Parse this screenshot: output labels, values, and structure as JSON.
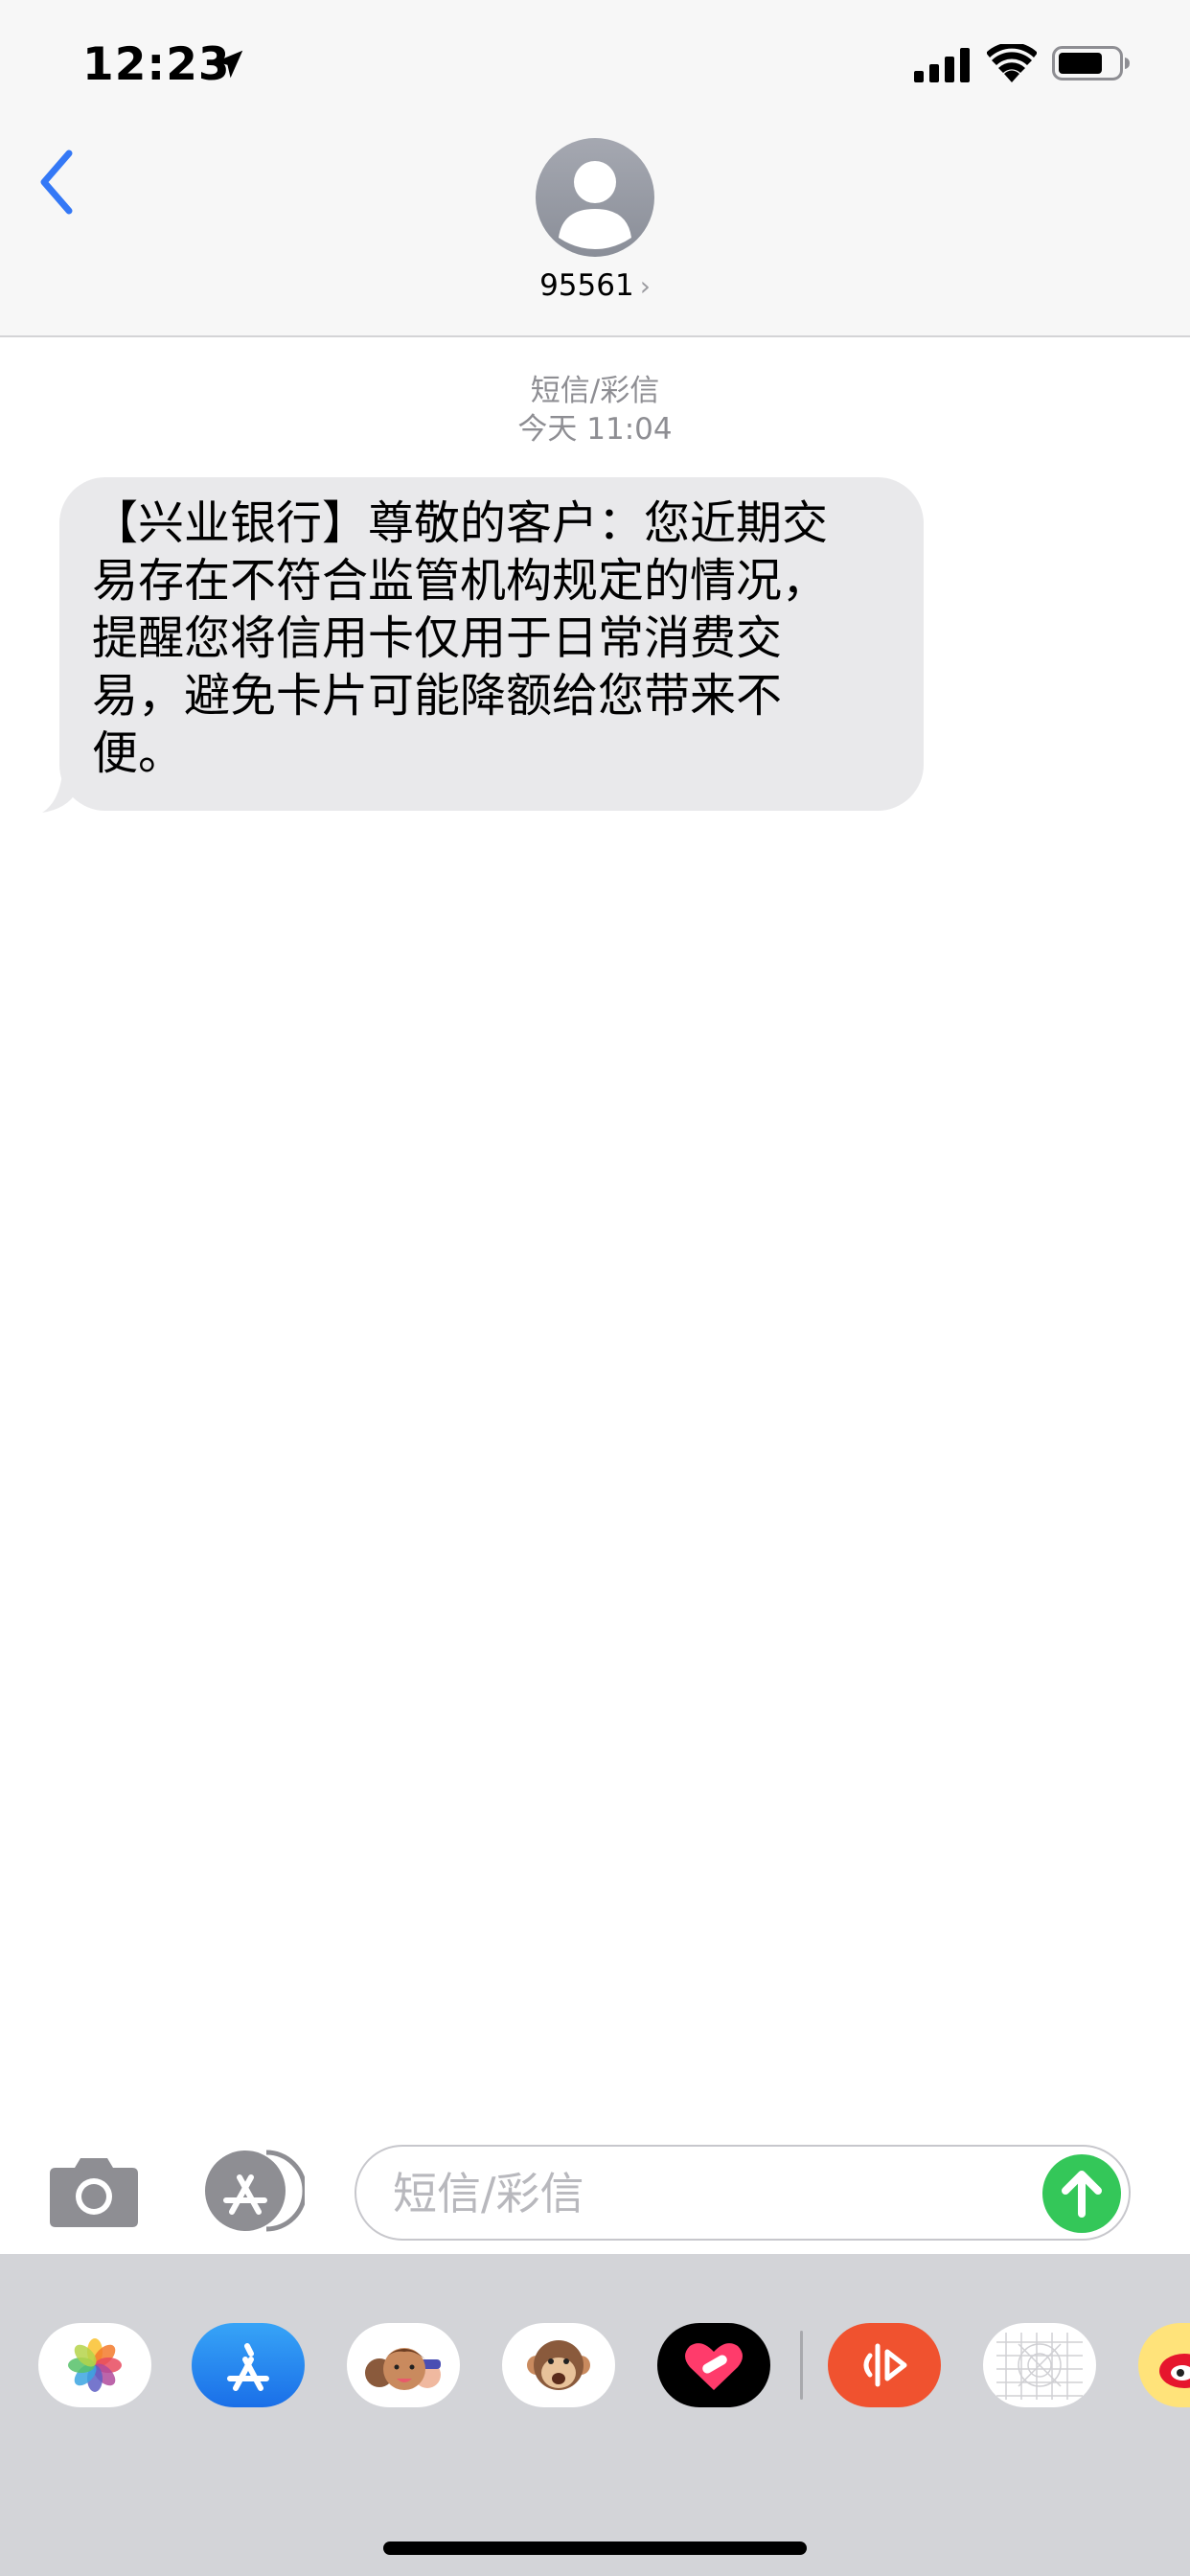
{
  "status_bar": {
    "time": "12:23",
    "icons": [
      "location-arrow-icon",
      "signal-icon",
      "wifi-icon",
      "battery-icon"
    ]
  },
  "header": {
    "back_icon": "chevron-left-icon",
    "contact_name": "95561",
    "contact_chevron": "›",
    "avatar_icon": "person-silhouette-icon"
  },
  "thread": {
    "service": "短信/彩信",
    "timestamp": "今天 11:04"
  },
  "messages": [
    {
      "direction": "incoming",
      "text": "【兴业银行】尊敬的客户：您近期交\n易存在不符合监管机构规定的情况，\n提醒您将信用卡仅用于日常消费交\n易，避免卡片可能降额给您带来不\n便。"
    }
  ],
  "input_bar": {
    "placeholder": "短信/彩信",
    "value": "",
    "camera_icon": "camera-icon",
    "apps_icon": "app-store-icon",
    "send_icon": "send-arrow-icon"
  },
  "app_drawer": {
    "apps": [
      "photos-app-icon",
      "app-store-app-icon",
      "memoji-app-icon",
      "animoji-app-icon",
      "digital-touch-app-icon",
      "music-app-icon",
      "stickers-grid-app-icon",
      "weibo-app-icon"
    ]
  },
  "colors": {
    "accent_blue": "#3478f6",
    "bubble_gray": "#e9e9eb",
    "send_green": "#34c759",
    "header_bg": "#f7f7f7",
    "drawer_bg": "#d3d4d8"
  }
}
